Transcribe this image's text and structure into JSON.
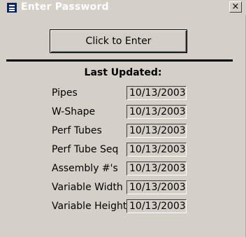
{
  "window": {
    "title": "Enter Password",
    "close_glyph": "×"
  },
  "buttons": {
    "enter_label": "Click to Enter"
  },
  "section": {
    "heading": "Last Updated:"
  },
  "rows": [
    {
      "label": "Pipes",
      "date": "10/13/2003"
    },
    {
      "label": "W-Shape",
      "date": "10/13/2003"
    },
    {
      "label": "Perf Tubes",
      "date": "10/13/2003"
    },
    {
      "label": "Perf Tube Seq",
      "date": "10/13/2003"
    },
    {
      "label": "Assembly #'s",
      "date": "10/13/2003"
    },
    {
      "label": "Variable Width",
      "date": "10/13/2003"
    },
    {
      "label": "Variable Height",
      "date": "10/13/2003"
    }
  ]
}
